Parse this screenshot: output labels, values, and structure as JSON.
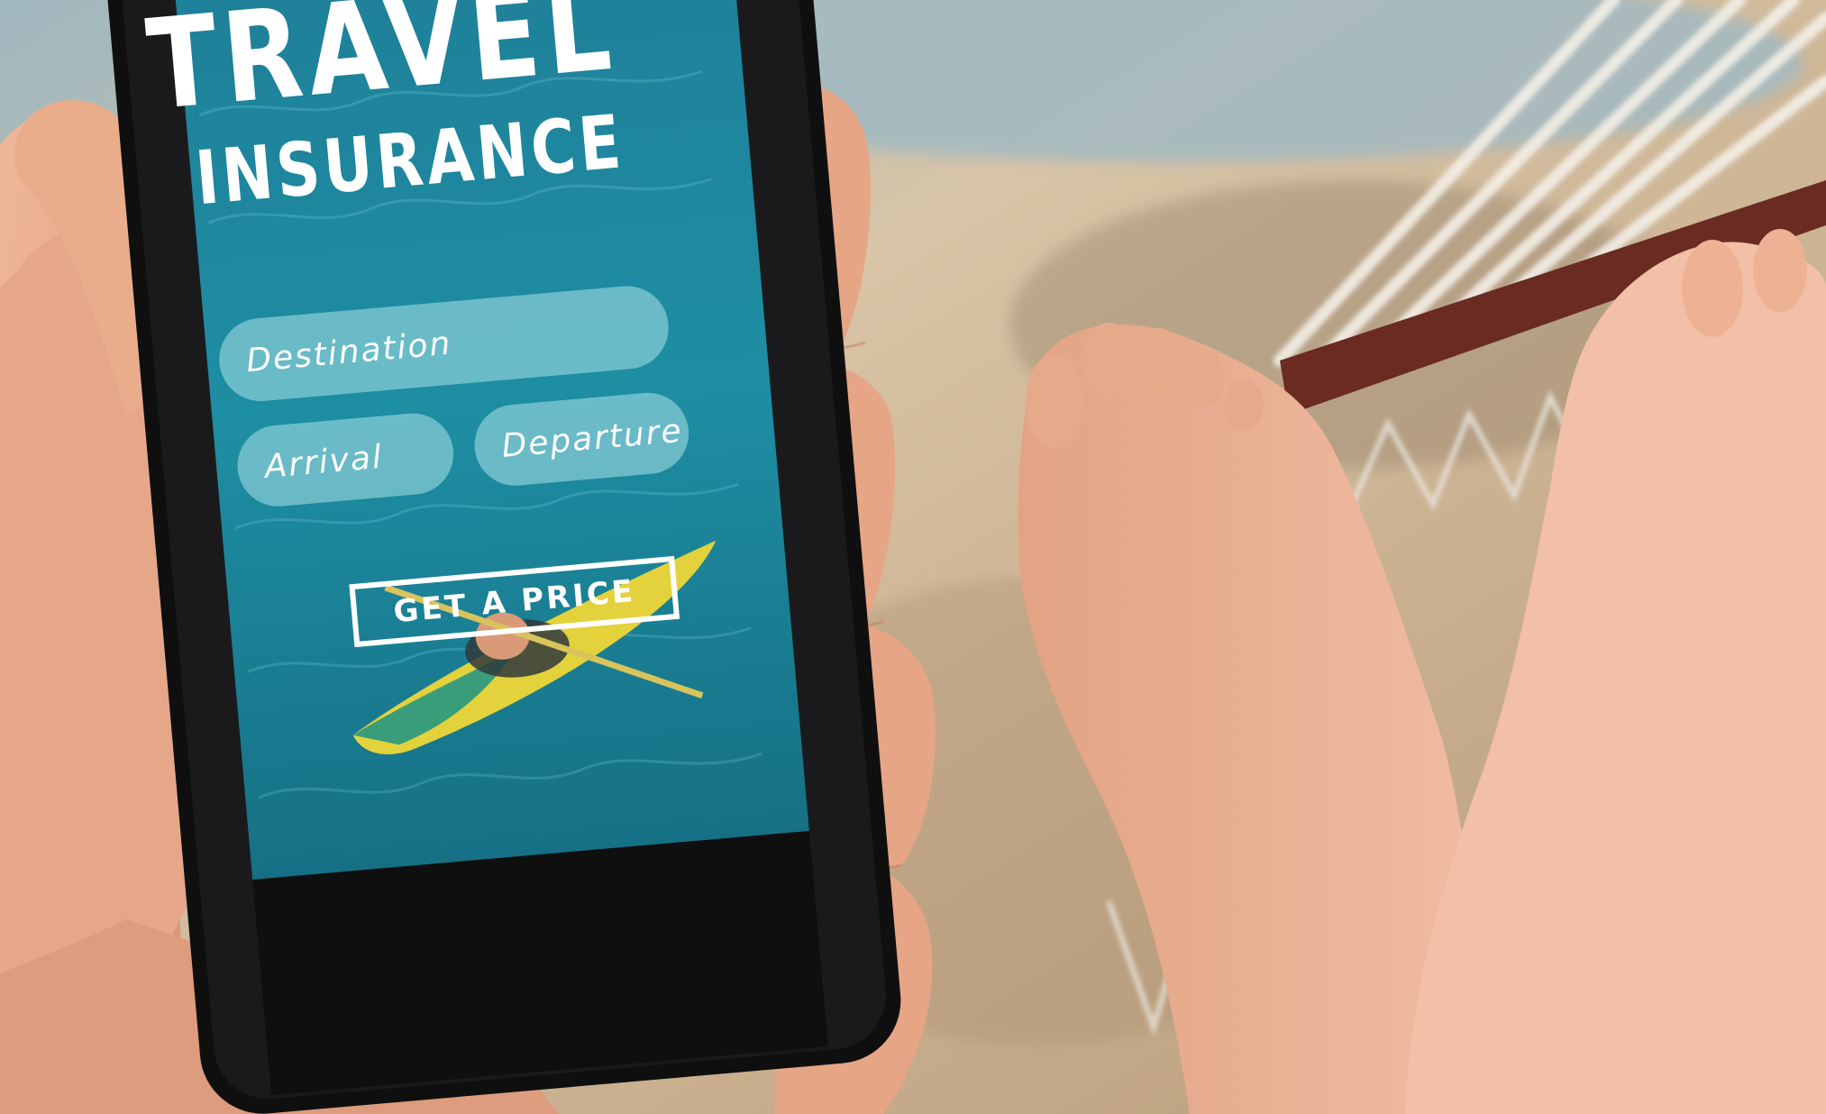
{
  "app": {
    "title_line_1": "TRAVEL",
    "title_line_2": "INSURANCE"
  },
  "form": {
    "destination_placeholder": "Destination",
    "arrival_placeholder": "Arrival",
    "departure_placeholder": "Departure",
    "cta_label": "GET A PRICE"
  },
  "colors": {
    "screen_background": "#1d7f96",
    "field_fill": "#9fd9e0",
    "text": "#ffffff",
    "phone_body": "#111111",
    "sand": "#cbb59a",
    "skin": "#e7a884",
    "hammock_bar": "#6a2b23",
    "kayak": "#e7d23a"
  }
}
